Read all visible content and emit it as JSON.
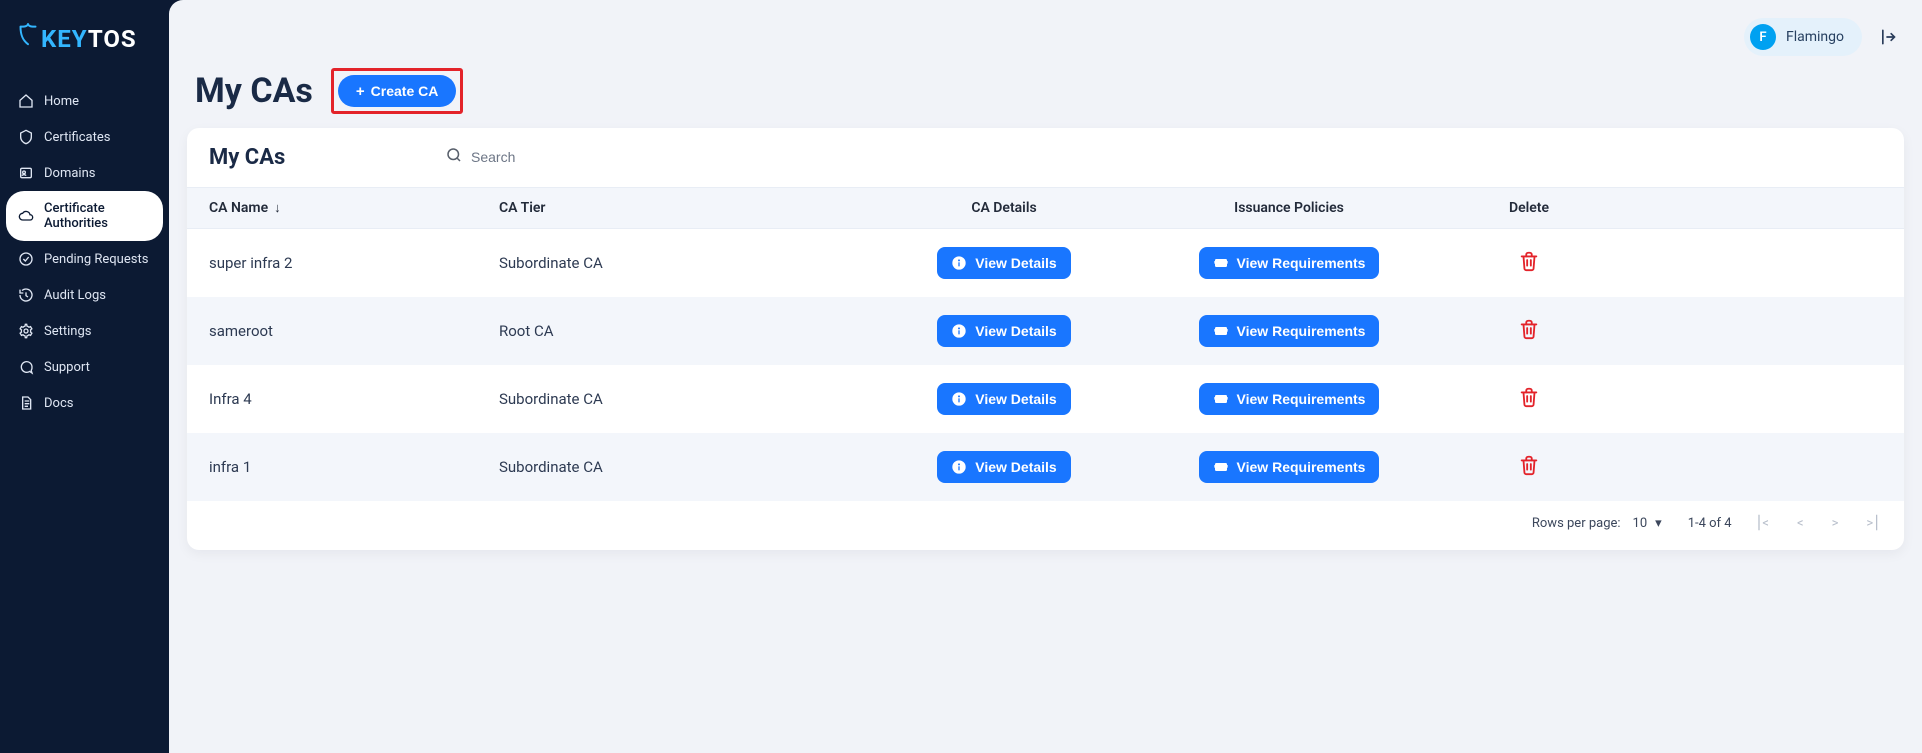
{
  "brand": {
    "key": "KEY",
    "tos": "TOS"
  },
  "sidebar": {
    "items": [
      {
        "label": "Home"
      },
      {
        "label": "Certificates"
      },
      {
        "label": "Domains"
      },
      {
        "label": "Certificate Authorities"
      },
      {
        "label": "Pending Requests"
      },
      {
        "label": "Audit Logs"
      },
      {
        "label": "Settings"
      },
      {
        "label": "Support"
      },
      {
        "label": "Docs"
      }
    ]
  },
  "header": {
    "user_initial": "F",
    "user_name": "Flamingo"
  },
  "page": {
    "title": "My CAs",
    "create_label": "Create CA"
  },
  "table": {
    "title": "My CAs",
    "search_placeholder": "Search",
    "columns": {
      "name": "CA Name",
      "tier": "CA Tier",
      "details": "CA Details",
      "policies": "Issuance Policies",
      "delete": "Delete"
    },
    "buttons": {
      "view_details": "View Details",
      "view_requirements": "View Requirements"
    },
    "rows": [
      {
        "name": "super infra 2",
        "tier": "Subordinate CA"
      },
      {
        "name": "sameroot",
        "tier": "Root CA"
      },
      {
        "name": "Infra 4",
        "tier": "Subordinate CA"
      },
      {
        "name": "infra 1",
        "tier": "Subordinate CA"
      }
    ],
    "footer": {
      "rows_per_page_label": "Rows per page:",
      "rows_per_page_value": "10",
      "range_label": "1-4 of 4"
    }
  }
}
